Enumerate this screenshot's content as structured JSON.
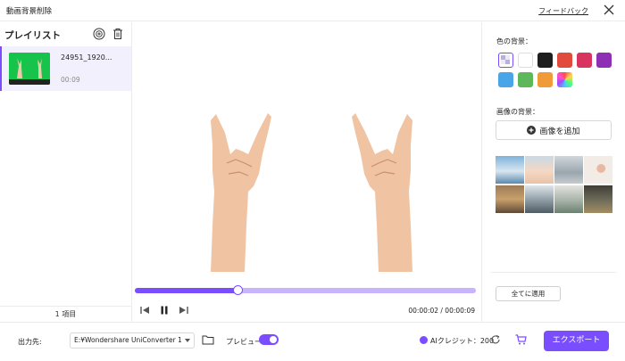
{
  "window": {
    "title": "動画背景削除",
    "feedback": "フィードバック"
  },
  "playlist": {
    "title": "プレイリスト",
    "items": [
      {
        "name": "24951_1920...",
        "duration": "00:09"
      }
    ],
    "count": "1 項目"
  },
  "player": {
    "progress": 0.3,
    "time_text": "00:00:02 / 00:00:09"
  },
  "background": {
    "color_label": "色の背景：",
    "colors": [
      "transparent",
      "#ffffff",
      "#1e1e1e",
      "#e24b3b",
      "#d8345f",
      "#8e2fb5",
      "#4aa4e8",
      "#5db85c",
      "#f09a38",
      "rainbow"
    ],
    "image_label": "画像の背景：",
    "add_image": "画像を追加",
    "apply_all": "全てに適用"
  },
  "footer": {
    "output_label": "出力先:",
    "output_path": "E:¥Wondershare UniConverter 1",
    "preview_label": "プレビュー",
    "preview_on": true,
    "credit_text": "AIクレジット：200",
    "export_label": "エクスポート"
  },
  "colors": {
    "accent": "#7a4dff",
    "accent_light": "#c8b3ff",
    "selected_bg": "#f3f0fd"
  }
}
